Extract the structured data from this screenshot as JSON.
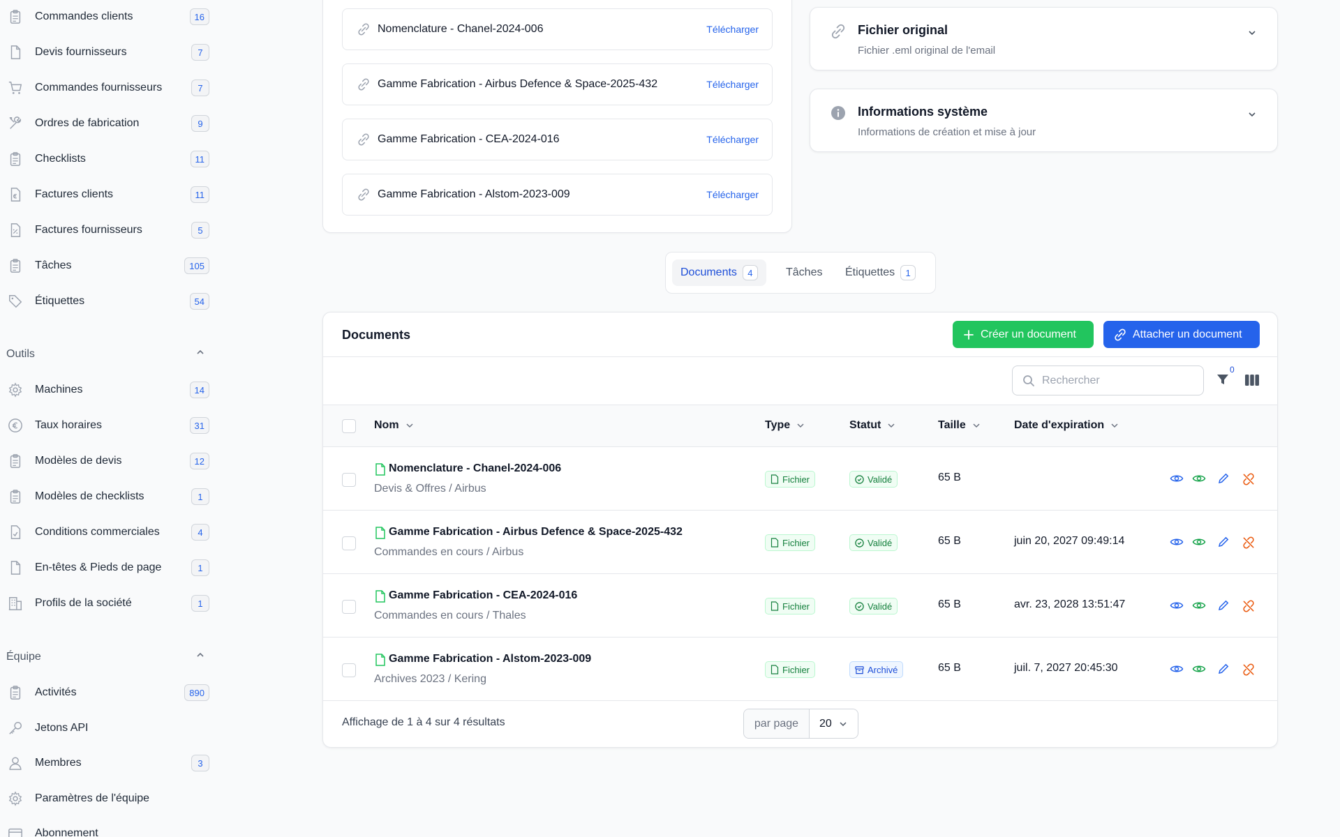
{
  "sidebar": {
    "items": [
      {
        "label": "Commandes clients",
        "count": "16",
        "icon": "clipboard-icon"
      },
      {
        "label": "Devis fournisseurs",
        "count": "7",
        "icon": "document-icon"
      },
      {
        "label": "Commandes fournisseurs",
        "count": "7",
        "icon": "cart-icon"
      },
      {
        "label": "Ordres de fabrication",
        "count": "9",
        "icon": "tools-icon"
      },
      {
        "label": "Checklists",
        "count": "11",
        "icon": "clipboard-icon"
      },
      {
        "label": "Factures clients",
        "count": "11",
        "icon": "invoice-euro-icon"
      },
      {
        "label": "Factures fournisseurs",
        "count": "5",
        "icon": "invoice-percent-icon"
      },
      {
        "label": "Tâches",
        "count": "105",
        "icon": "clipboard-icon"
      },
      {
        "label": "Étiquettes",
        "count": "54",
        "icon": "tag-icon"
      }
    ],
    "outils_title": "Outils",
    "outils": [
      {
        "label": "Machines",
        "count": "14",
        "icon": "gear-icon"
      },
      {
        "label": "Taux horaires",
        "count": "31",
        "icon": "euro-icon"
      },
      {
        "label": "Modèles de devis",
        "count": "12",
        "icon": "clipboard-icon"
      },
      {
        "label": "Modèles de checklists",
        "count": "1",
        "icon": "clipboard-icon"
      },
      {
        "label": "Conditions commerciales",
        "count": "4",
        "icon": "document-check-icon"
      },
      {
        "label": "En-têtes & Pieds de page",
        "count": "1",
        "icon": "document-icon"
      },
      {
        "label": "Profils de la société",
        "count": "1",
        "icon": "building-icon"
      }
    ],
    "equipe_title": "Équipe",
    "equipe": [
      {
        "label": "Activités",
        "count": "890",
        "icon": "clipboard-icon"
      },
      {
        "label": "Jetons API",
        "count": "",
        "icon": "key-icon"
      },
      {
        "label": "Membres",
        "count": "3",
        "icon": "user-icon"
      },
      {
        "label": "Paramètres de l'équipe",
        "count": "",
        "icon": "gear-icon"
      },
      {
        "label": "Abonnement",
        "count": "",
        "icon": "card-icon"
      }
    ]
  },
  "attachments": {
    "download_label": "Télécharger",
    "items": [
      "Nomenclature - Chanel-2024-006",
      "Gamme Fabrication - Airbus Defence & Space-2025-432",
      "Gamme Fabrication - CEA-2024-016",
      "Gamme Fabrication - Alstom-2023-009"
    ]
  },
  "side_cards": [
    {
      "title": "Fichier original",
      "subtitle": "Fichier .eml original de l'email",
      "icon": "paperclip-icon"
    },
    {
      "title": "Informations système",
      "subtitle": "Informations de création et mise à jour",
      "icon": "info-icon"
    }
  ],
  "tabs": [
    {
      "label": "Documents",
      "count": "4",
      "active": true
    },
    {
      "label": "Tâches",
      "count": "",
      "active": false
    },
    {
      "label": "Étiquettes",
      "count": "1",
      "active": false
    }
  ],
  "documents": {
    "title": "Documents",
    "create_label": "Créer un document",
    "attach_label": "Attacher un document",
    "search_placeholder": "Rechercher",
    "filter_count": "0",
    "columns": {
      "name": "Nom",
      "type": "Type",
      "status": "Statut",
      "size": "Taille",
      "expiry": "Date d'expiration"
    },
    "rows": [
      {
        "name": "Nomenclature - Chanel-2024-006",
        "path": "Devis & Offres / Airbus",
        "type": "Fichier",
        "status": "Validé",
        "status_kind": "ok",
        "size": "65 B",
        "expiry": ""
      },
      {
        "name": "Gamme Fabrication - Airbus Defence & Space-2025-432",
        "path": "Commandes en cours / Airbus",
        "type": "Fichier",
        "status": "Validé",
        "status_kind": "ok",
        "size": "65 B",
        "expiry": "juin 20, 2027 09:49:14"
      },
      {
        "name": "Gamme Fabrication - CEA-2024-016",
        "path": "Commandes en cours / Thales",
        "type": "Fichier",
        "status": "Validé",
        "status_kind": "ok",
        "size": "65 B",
        "expiry": "avr. 23, 2028 13:51:47"
      },
      {
        "name": "Gamme Fabrication - Alstom-2023-009",
        "path": "Archives 2023 / Kering",
        "type": "Fichier",
        "status": "Archivé",
        "status_kind": "arch",
        "size": "65 B",
        "expiry": "juil. 7, 2027 20:45:30"
      }
    ],
    "footer": "Affichage de 1 à 4 sur 4 résultats",
    "per_page_label": "par page",
    "per_page_value": "20"
  },
  "colors": {
    "accent": "#2563eb",
    "success": "#22c55e"
  }
}
